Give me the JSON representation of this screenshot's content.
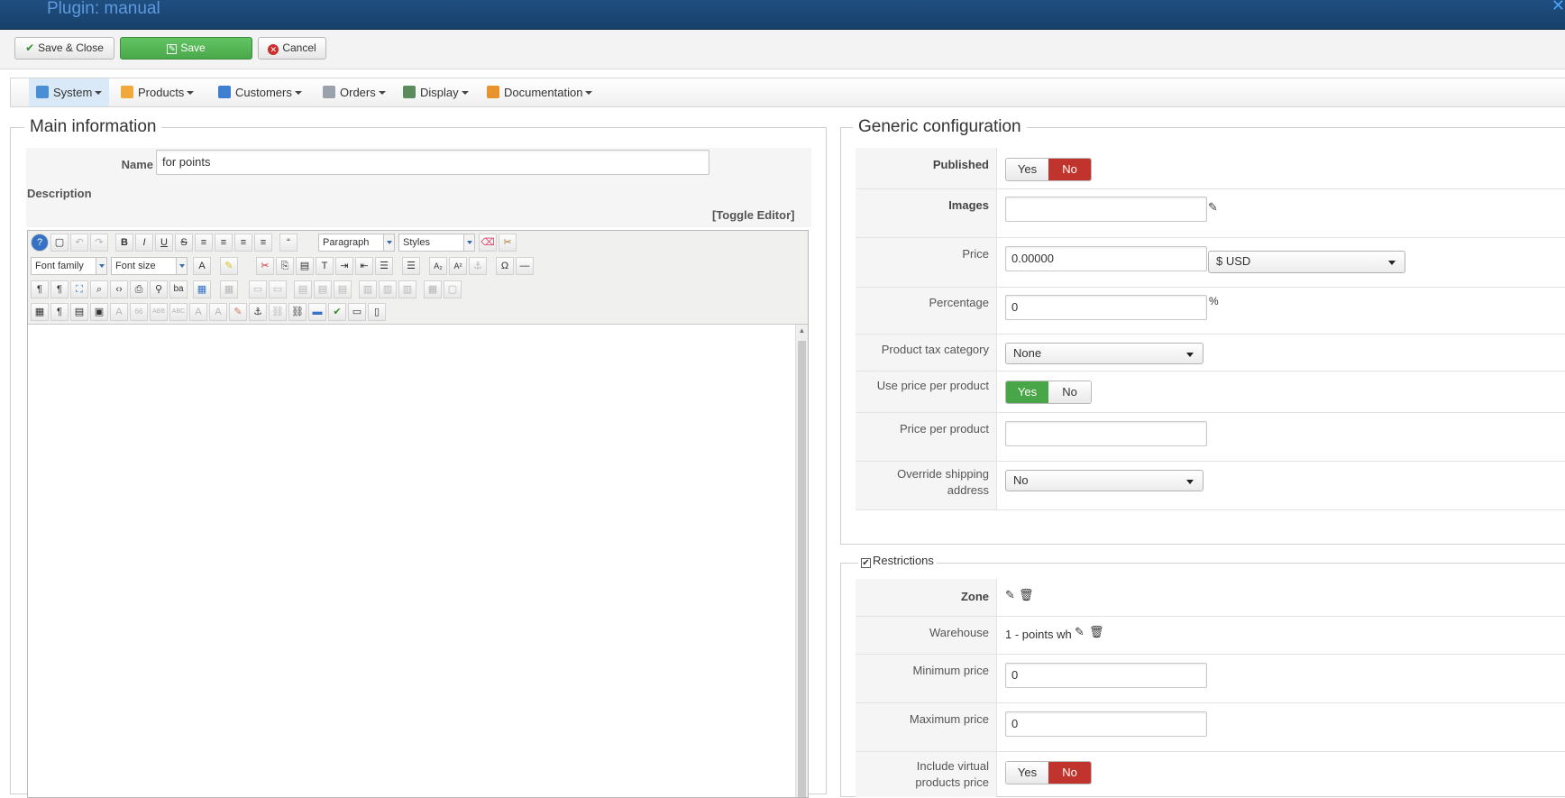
{
  "header": {
    "title": "Plugin: manual"
  },
  "toolbar": {
    "save_close": "Save & Close",
    "save": "Save",
    "cancel": "Cancel"
  },
  "menu": [
    {
      "label": "System",
      "icon": "wrench-icon",
      "color": "#4a8fd6"
    },
    {
      "label": "Products",
      "icon": "box-icon",
      "color": "#f2a93b"
    },
    {
      "label": "Customers",
      "icon": "users-icon",
      "color": "#3f7fd1"
    },
    {
      "label": "Orders",
      "icon": "orders-icon",
      "color": "#9aa3ab"
    },
    {
      "label": "Display",
      "icon": "display-icon",
      "color": "#5c8c5c"
    },
    {
      "label": "Documentation",
      "icon": "docs-icon",
      "color": "#e8932c"
    }
  ],
  "main": {
    "legend": "Main information",
    "name_label": "Name",
    "name_value": "for points",
    "description_label": "Description",
    "toggle_editor": "[Toggle Editor]",
    "editor": {
      "paragraph": "Paragraph",
      "styles": "Styles",
      "font_family": "Font family",
      "font_size": "Font size"
    }
  },
  "generic": {
    "legend": "Generic configuration",
    "published_label": "Published",
    "yes": "Yes",
    "no": "No",
    "images_label": "Images",
    "images_value": "",
    "price_label": "Price",
    "price_value": "0.00000",
    "currency": "$ USD",
    "percentage_label": "Percentage",
    "percentage_value": "0",
    "percent_sign": "%",
    "tax_label": "Product tax category",
    "tax_value": "None",
    "use_price_label": "Use price per product",
    "price_per_product_label": "Price per product",
    "price_per_product_value": "",
    "override_label_1": "Override shipping",
    "override_label_2": "address",
    "override_value": "No"
  },
  "restrictions": {
    "legend": "Restrictions",
    "zone_label": "Zone",
    "warehouse_label": "Warehouse",
    "warehouse_value": "1 - points wh",
    "min_price_label": "Minimum price",
    "min_price_value": "0",
    "max_price_label": "Maximum price",
    "max_price_value": "0",
    "include_virtual_label_1": "Include virtual",
    "include_virtual_label_2": "products price"
  }
}
